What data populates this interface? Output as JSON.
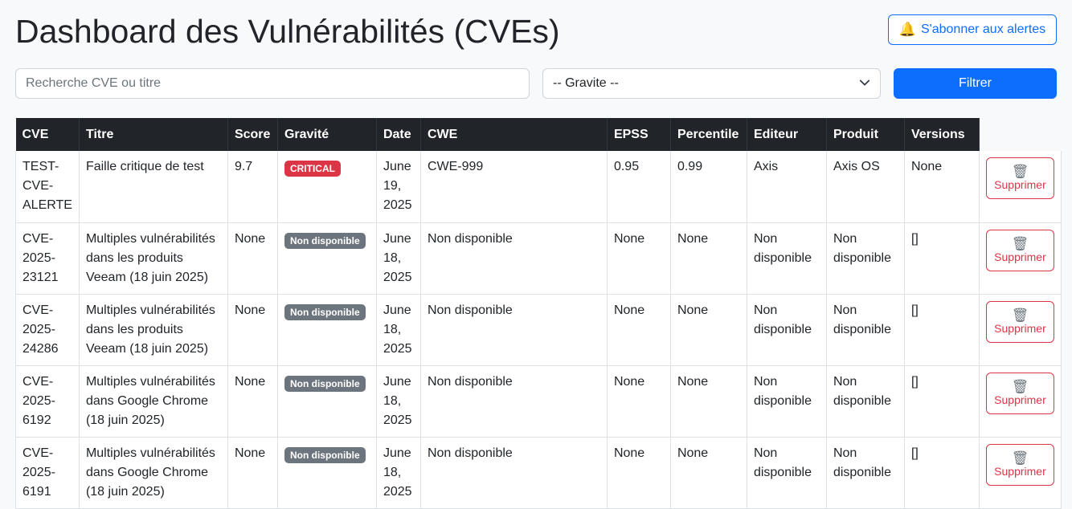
{
  "page": {
    "title": "Dashboard des Vulnérabilités (CVEs)",
    "subscribe_label": "S'abonner aux alertes",
    "subscribe_icon": "bell-icon"
  },
  "filters": {
    "search_placeholder": "Recherche CVE ou titre",
    "gravity_selected": "-- Gravite --",
    "filter_label": "Filtrer"
  },
  "colors": {
    "primary": "#0d6efd",
    "danger": "#dc3545",
    "critical_badge": "#dc3545",
    "unavailable_badge": "#6c757d",
    "table_header": "#212529"
  },
  "table": {
    "headers": [
      "CVE",
      "Titre",
      "Score",
      "Gravité",
      "Date",
      "CWE",
      "EPSS",
      "Percentile",
      "Editeur",
      "Produit",
      "Versions"
    ],
    "delete_label": "Supprimer",
    "delete_icon": "trash-icon",
    "rows": [
      {
        "cve": "TEST-CVE-ALERTE",
        "titre": "Faille critique de test",
        "score": "9.7",
        "gravite": "CRITICAL",
        "gravite_color": "#dc3545",
        "date": "June 19, 2025",
        "cwe": "CWE-999",
        "epss": "0.95",
        "percentile": "0.99",
        "editeur": "Axis",
        "produit": "Axis OS",
        "versions": "None"
      },
      {
        "cve": "CVE-2025-23121",
        "titre": "Multiples vulnérabilités dans les produits Veeam (18 juin 2025)",
        "score": "None",
        "gravite": "Non disponible",
        "gravite_color": "#6c757d",
        "date": "June 18, 2025",
        "cwe": "Non disponible",
        "epss": "None",
        "percentile": "None",
        "editeur": "Non disponible",
        "produit": "Non disponible",
        "versions": "[]"
      },
      {
        "cve": "CVE-2025-24286",
        "titre": "Multiples vulnérabilités dans les produits Veeam (18 juin 2025)",
        "score": "None",
        "gravite": "Non disponible",
        "gravite_color": "#6c757d",
        "date": "June 18, 2025",
        "cwe": "Non disponible",
        "epss": "None",
        "percentile": "None",
        "editeur": "Non disponible",
        "produit": "Non disponible",
        "versions": "[]"
      },
      {
        "cve": "CVE-2025-6192",
        "titre": "Multiples vulnérabilités dans Google Chrome (18 juin 2025)",
        "score": "None",
        "gravite": "Non disponible",
        "gravite_color": "#6c757d",
        "date": "June 18, 2025",
        "cwe": "Non disponible",
        "epss": "None",
        "percentile": "None",
        "editeur": "Non disponible",
        "produit": "Non disponible",
        "versions": "[]"
      },
      {
        "cve": "CVE-2025-6191",
        "titre": "Multiples vulnérabilités dans Google Chrome (18 juin 2025)",
        "score": "None",
        "gravite": "Non disponible",
        "gravite_color": "#6c757d",
        "date": "June 18, 2025",
        "cwe": "Non disponible",
        "epss": "None",
        "percentile": "None",
        "editeur": "Non disponible",
        "produit": "Non disponible",
        "versions": "[]"
      }
    ]
  }
}
